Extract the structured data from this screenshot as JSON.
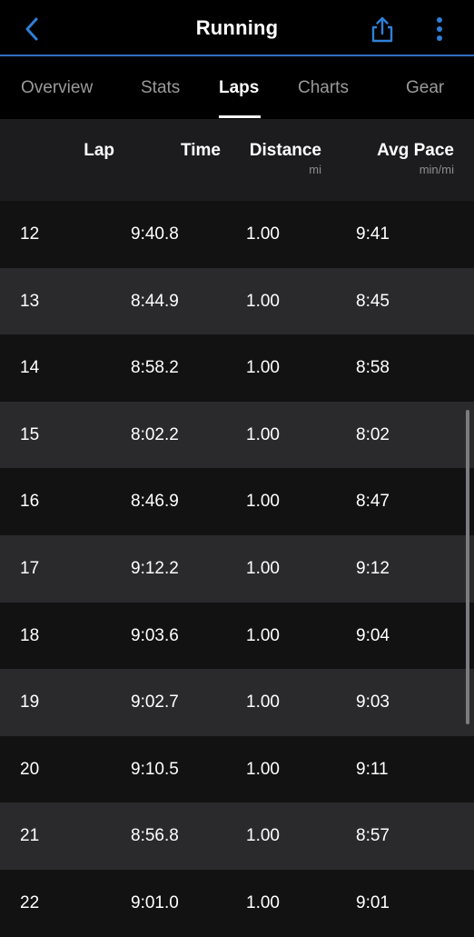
{
  "header": {
    "title": "Running",
    "icons": {
      "back": "chevron-left-icon",
      "share": "share-icon",
      "more": "more-vertical-icon"
    },
    "accent_color": "#2f7fd8"
  },
  "tabs": [
    {
      "label": "Overview",
      "active": false
    },
    {
      "label": "Stats",
      "active": false
    },
    {
      "label": "Laps",
      "active": true
    },
    {
      "label": "Charts",
      "active": false
    },
    {
      "label": "Gear",
      "active": false
    }
  ],
  "table": {
    "columns": [
      {
        "label": "Lap",
        "unit": ""
      },
      {
        "label": "Time",
        "unit": ""
      },
      {
        "label": "Distance",
        "unit": "mi"
      },
      {
        "label": "Avg Pace",
        "unit": "min/mi"
      }
    ],
    "rows": [
      {
        "lap": "12",
        "time": "9:40.8",
        "distance": "1.00",
        "pace": "9:41"
      },
      {
        "lap": "13",
        "time": "8:44.9",
        "distance": "1.00",
        "pace": "8:45"
      },
      {
        "lap": "14",
        "time": "8:58.2",
        "distance": "1.00",
        "pace": "8:58"
      },
      {
        "lap": "15",
        "time": "8:02.2",
        "distance": "1.00",
        "pace": "8:02"
      },
      {
        "lap": "16",
        "time": "8:46.9",
        "distance": "1.00",
        "pace": "8:47"
      },
      {
        "lap": "17",
        "time": "9:12.2",
        "distance": "1.00",
        "pace": "9:12"
      },
      {
        "lap": "18",
        "time": "9:03.6",
        "distance": "1.00",
        "pace": "9:04"
      },
      {
        "lap": "19",
        "time": "9:02.7",
        "distance": "1.00",
        "pace": "9:03"
      },
      {
        "lap": "20",
        "time": "9:10.5",
        "distance": "1.00",
        "pace": "9:11"
      },
      {
        "lap": "21",
        "time": "8:56.8",
        "distance": "1.00",
        "pace": "8:57"
      },
      {
        "lap": "22",
        "time": "9:01.0",
        "distance": "1.00",
        "pace": "9:01"
      }
    ]
  }
}
